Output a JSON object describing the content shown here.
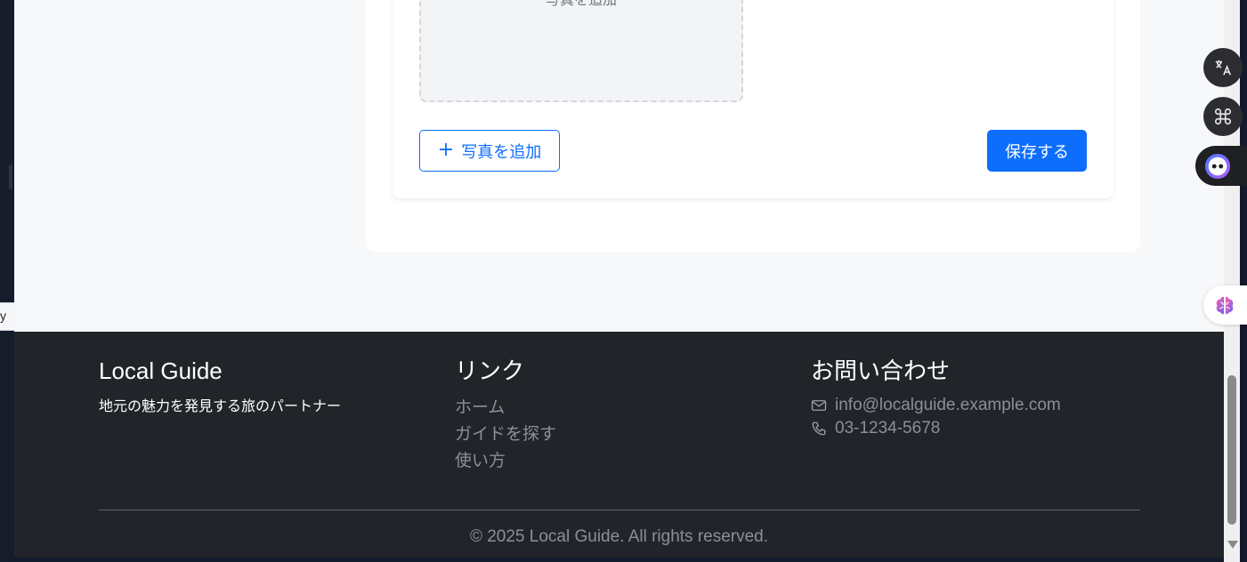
{
  "form": {
    "photo_slot_label": "写真を追加",
    "add_photo_button": "写真を追加",
    "add_photo_icon": "plus-icon",
    "save_button": "保存する"
  },
  "left_edge": {
    "clipped_text": "y"
  },
  "footer": {
    "brand": {
      "title": "Local Guide",
      "tagline": "地元の魅力を発見する旅のパートナー"
    },
    "links": {
      "heading": "リンク",
      "items": [
        {
          "label": "ホーム"
        },
        {
          "label": "ガイドを探す"
        },
        {
          "label": "使い方"
        }
      ]
    },
    "contact": {
      "heading": "お問い合わせ",
      "email": "info@localguide.example.com",
      "email_icon": "envelope-icon",
      "phone": "03-1234-5678",
      "phone_icon": "phone-icon"
    },
    "copyright": "© 2025 Local Guide. All rights reserved."
  },
  "floating_tools": [
    {
      "name": "translate",
      "icon": "translate-icon"
    },
    {
      "name": "apps",
      "icon": "command-icon"
    },
    {
      "name": "assistant",
      "icon": "ai-face-icon"
    },
    {
      "name": "brain",
      "icon": "brain-icon"
    }
  ],
  "colors": {
    "primary": "#0d6efd",
    "footer_bg": "#212529",
    "muted_text": "#8b9096",
    "page_bg": "#f7f8fa"
  }
}
